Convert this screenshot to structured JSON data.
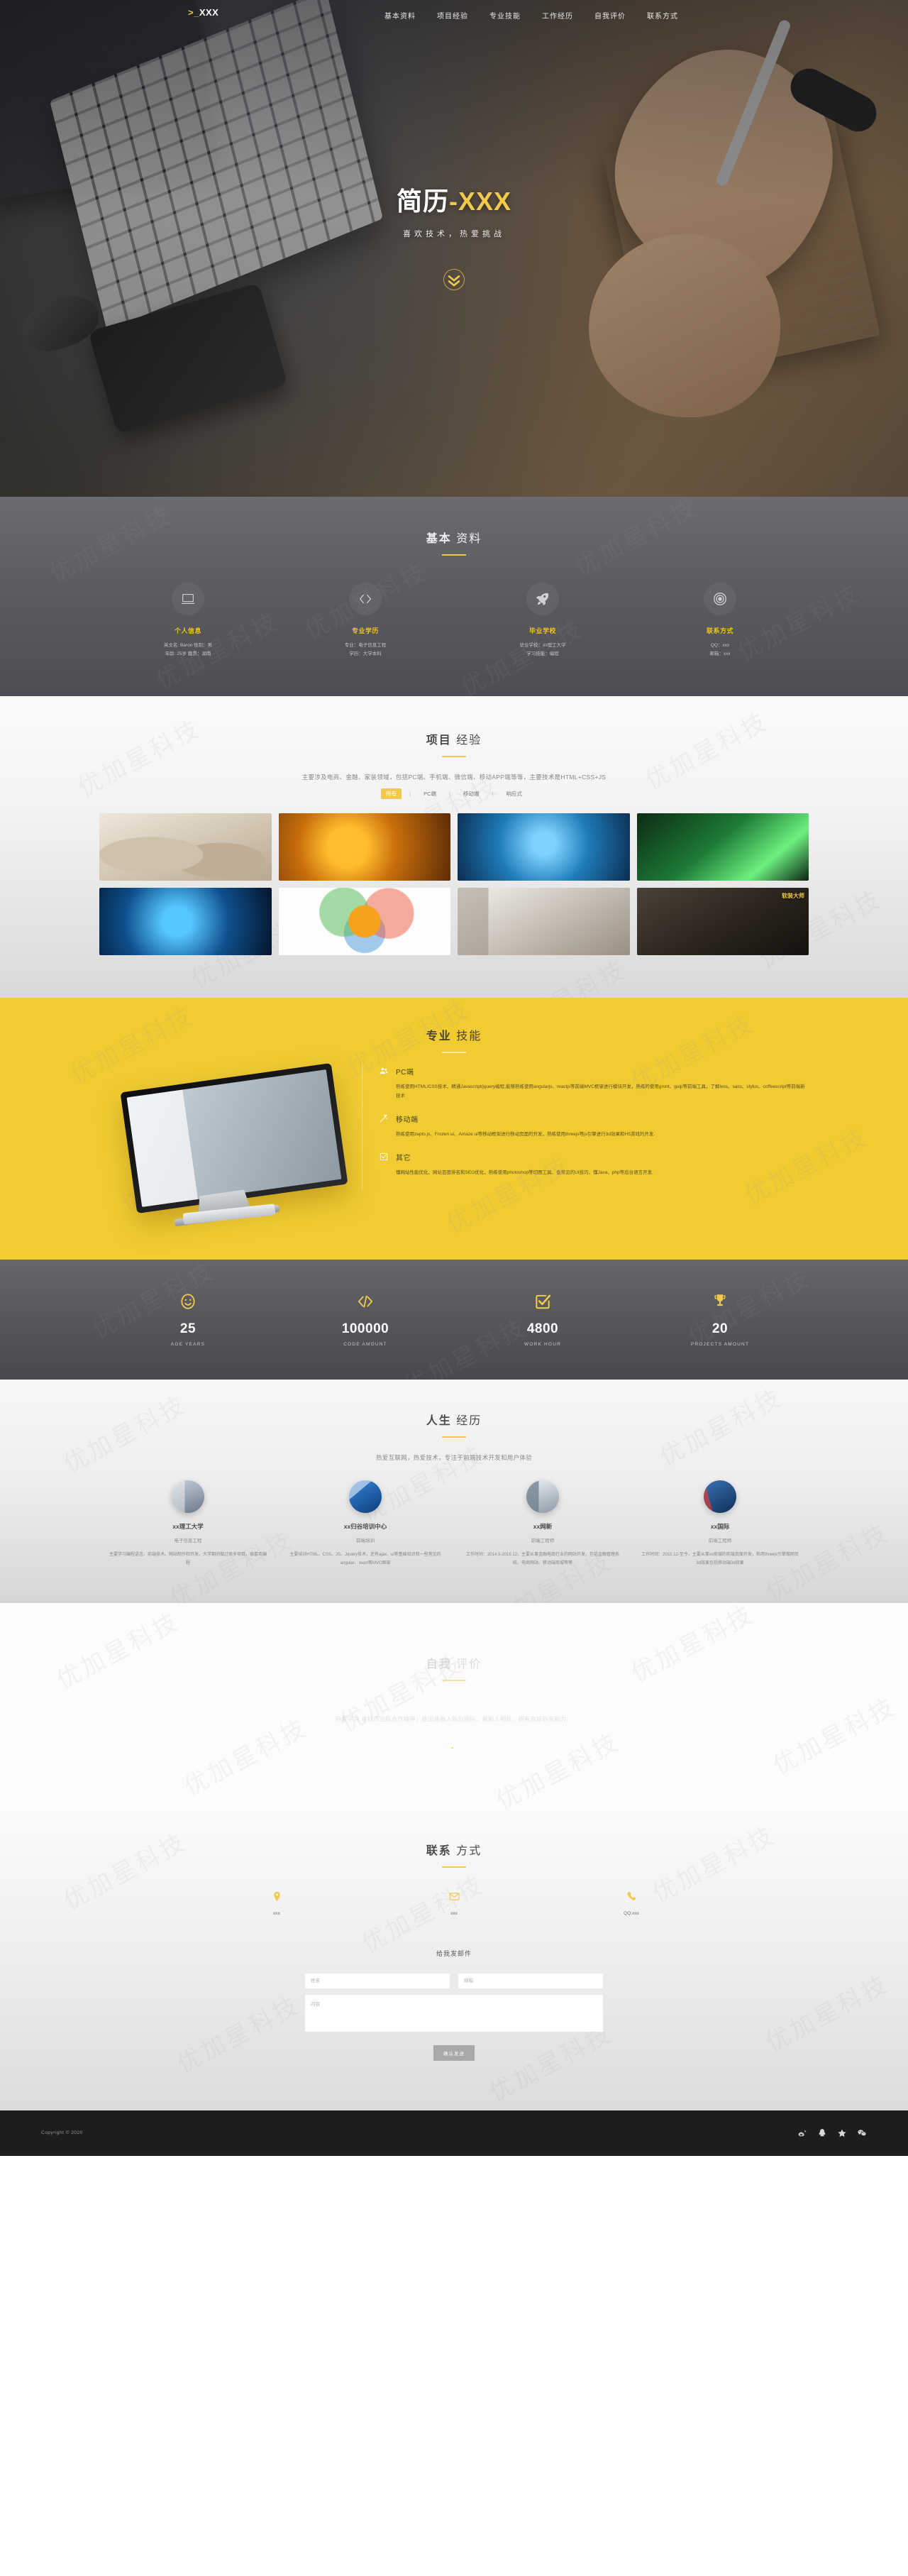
{
  "nav": {
    "logo": ">_XXX",
    "items": [
      {
        "label": "基本资料"
      },
      {
        "label": "项目经验"
      },
      {
        "label": "专业技能"
      },
      {
        "label": "工作经历"
      },
      {
        "label": "自我评价"
      },
      {
        "label": "联系方式"
      }
    ]
  },
  "hero": {
    "title_main": "简历",
    "title_accent": "-XXX",
    "subtitle": "喜欢技术，热爱挑战",
    "scroll_icon": "chevron-double-down-icon"
  },
  "basic": {
    "title_bold": "基本",
    "title_light": "资料",
    "items": [
      {
        "icon": "laptop-icon",
        "name": "个人信息",
        "line1": "英文名: Baron  性别：男",
        "line2": "年龄: 25岁  籍贯：湖南"
      },
      {
        "icon": "code-icon",
        "name": "专业学历",
        "line1": "专业：电子信息工程",
        "line2": "学历：大学本科"
      },
      {
        "icon": "rocket-icon",
        "name": "毕业学校",
        "line1": "毕业学校：xx理工大学",
        "line2": "学习技能：编程"
      },
      {
        "icon": "target-icon",
        "name": "联系方式",
        "line1": "QQ：xxx",
        "line2": "邮箱：xxx"
      }
    ]
  },
  "projects": {
    "title_bold": "项目",
    "title_light": "经验",
    "desc": "主要涉及电商、金融、家装领域，包括PC端、手机端、微信端、移动APP端等等，主要技术是HTML+CSS+JS",
    "filters": [
      {
        "label": "所有",
        "active": true
      },
      {
        "label": "PC端",
        "active": false
      },
      {
        "label": "移动端",
        "active": false
      },
      {
        "label": "响应式",
        "active": false
      }
    ],
    "cards": [
      {
        "style": "img-sofa",
        "label": ""
      },
      {
        "style": "img-gold",
        "label": ""
      },
      {
        "style": "img-blue",
        "label": ""
      },
      {
        "style": "img-dna1",
        "label": ""
      },
      {
        "style": "img-dna2",
        "label": ""
      },
      {
        "style": "img-ceo",
        "label": ""
      },
      {
        "style": "img-office",
        "label": ""
      },
      {
        "style": "img-dark",
        "label": "软装大师"
      }
    ]
  },
  "skills": {
    "title_bold": "专业",
    "title_light": "技能",
    "items": [
      {
        "icon": "users-icon",
        "name": "PC端",
        "desc": "熟练使用HTML/CSS技术、精通Javascript/jquery编程,能够熟练使用angularjs、reactjs等前端MVC框架进行模块开发，熟练的使用grunt、gulp等前端工具，了解less、sass、stylus、coffeescript等前端新技术"
      },
      {
        "icon": "wand-icon",
        "name": "移动端",
        "desc": "熟练使用zepto.js、Frozen ui、Amaze ui等移动框架进行移动页面的开发，熟练使用threejs等js引擎进行3d效果和H5游戏的开发."
      },
      {
        "icon": "check-square-icon",
        "name": "其它",
        "desc": "懂网站性能优化、网站百度排名和SEO优化，熟练使用photoshop等切图工具、会常见的UI技巧、懂Java、php等后台语言开发."
      }
    ]
  },
  "counters": {
    "items": [
      {
        "icon": "smile-icon",
        "number": "25",
        "label": "AGE YEARS"
      },
      {
        "icon": "code-icon",
        "number": "100000",
        "label": "CODE AMOUNT"
      },
      {
        "icon": "check-square-icon",
        "number": "4800",
        "label": "WORK HOUR"
      },
      {
        "icon": "trophy-icon",
        "number": "20",
        "label": "PROJECTS AMOUNT"
      }
    ]
  },
  "life": {
    "title_bold": "人生",
    "title_light": "经历",
    "desc": "热爱互联网，热爱技术，专注于前端技术开发和用户体验",
    "items": [
      {
        "photo": "ph1",
        "name": "xx理工大学",
        "role": "电子信息工程",
        "desc": "主要学习编程语言、前端技术、网站制作和开发。大学期间做过很多项目。很喜欢编程"
      },
      {
        "photo": "ph2",
        "name": "xx归谷培训中心",
        "role": "前端培训",
        "desc": "主要培训HTML、CSS、JS、Jquery技术，还有ajax、ui等基础知识和一些常见的angular、react等MVC框架"
      },
      {
        "photo": "ph3",
        "name": "xx网新",
        "role": "前端工程师",
        "desc": "工作时间：2014.5-2015.12，主要从事金融电商行业的网站开发，包括金融管理系统、电商网站、移动端商城等等"
      },
      {
        "photo": "ph4",
        "name": "xx国际",
        "role": "前端工程师",
        "desc": "工作时间：2015.12-至今，主要从事xx商城的前端页面开发，和用threejs引擎做网页3d效果包括移动端3d效果"
      }
    ]
  },
  "selfeval": {
    "title_bold": "自我",
    "title_light": "评价",
    "text": "热爱学习,良好的团队合作精神，能迅速融入新的团队，易和人相处，拥有良好的亲和力。",
    "dots": "•"
  },
  "contact": {
    "title_bold": "联系",
    "title_light": "方式",
    "items": [
      {
        "icon": "map-pin-icon",
        "value": "xxx"
      },
      {
        "icon": "envelope-icon",
        "value": "xxx"
      },
      {
        "icon": "phone-icon",
        "value": "QQ:xxx"
      }
    ],
    "mail_title": "给我发邮件",
    "form": {
      "name_placeholder": "姓名",
      "name_value": "",
      "email_placeholder": "邮箱",
      "email_value": "",
      "message_placeholder": "内容",
      "message_value": "",
      "submit_label": "确认发送"
    }
  },
  "footer": {
    "copyright": "Copyright © 2020",
    "socials": [
      {
        "icon": "weibo-icon"
      },
      {
        "icon": "qq-icon"
      },
      {
        "icon": "star-icon"
      },
      {
        "icon": "wechat-icon"
      }
    ]
  },
  "watermark": {
    "text": "优加星科技"
  },
  "colors": {
    "accent": "#f2c94c",
    "skills_bg": "#f0cb32",
    "dark_panel": "#55575b",
    "footer_bg": "#1d1d1d"
  }
}
